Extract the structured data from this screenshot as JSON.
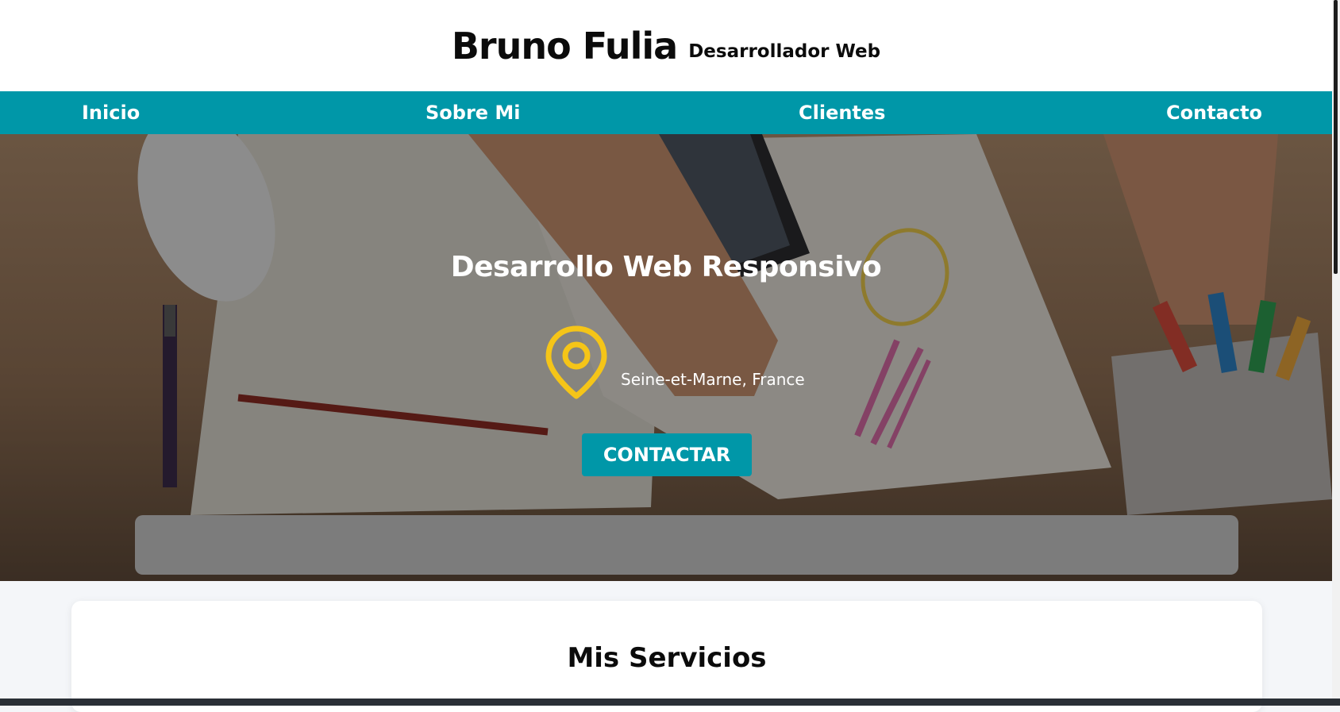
{
  "header": {
    "name": "Bruno Fulia",
    "tagline": "Desarrollador Web"
  },
  "nav": {
    "items": [
      {
        "label": "Inicio"
      },
      {
        "label": "Sobre Mi"
      },
      {
        "label": "Clientes"
      },
      {
        "label": "Contacto"
      }
    ]
  },
  "hero": {
    "title": "Desarrollo Web Responsivo",
    "location": "Seine-et-Marne, France",
    "button_label": "CONTACTAR",
    "icon": "location-pin-icon"
  },
  "services": {
    "title": "Mis Servicios"
  },
  "colors": {
    "accent": "#0097a8",
    "pin": "#f5c518",
    "text_dark": "#0b0b0b"
  }
}
